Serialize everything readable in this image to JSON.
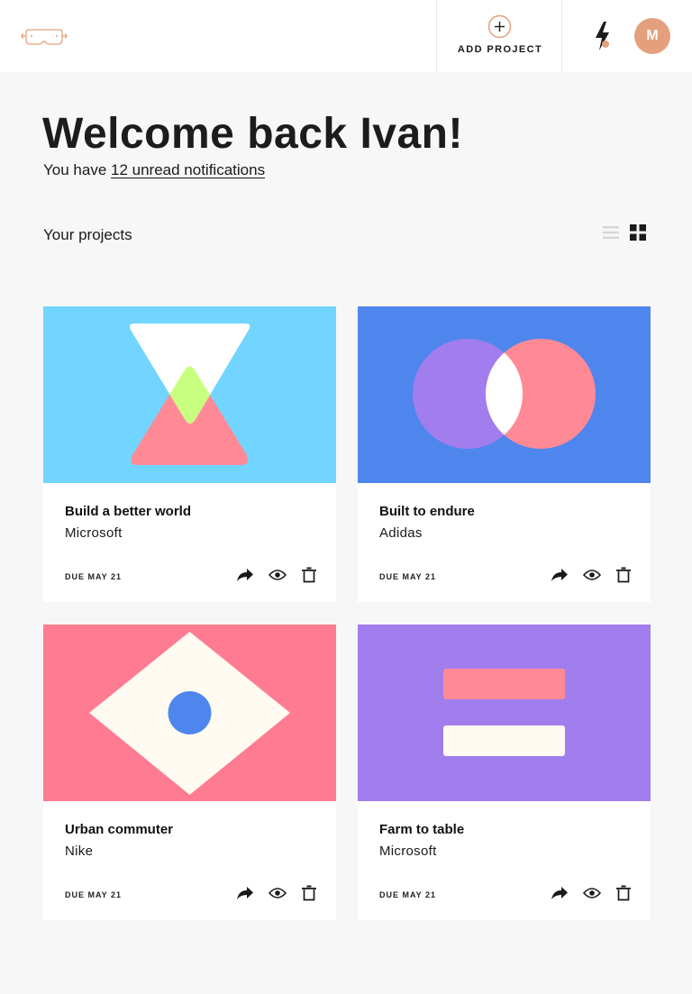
{
  "header": {
    "logo_icon": "mask-logo-icon",
    "add_project_label": "ADD PROJECT",
    "add_icon": "plus-circle-icon",
    "notification_icon": "bolt-icon",
    "avatar_initial": "M",
    "accent_color": "#e4a07d"
  },
  "welcome": {
    "title": "Welcome back Ivan!",
    "prefix": "You have ",
    "notifications_link": "12 unread notifications"
  },
  "projects": {
    "section_title": "Your projects",
    "view_options": [
      "list-view-icon",
      "grid-view-icon"
    ],
    "active_view": "grid",
    "items": [
      {
        "title": "Build a better world",
        "client": "Microsoft",
        "due": "DUE MAY 21",
        "art_color": "#72d5ff"
      },
      {
        "title": "Built to endure",
        "client": "Adidas",
        "due": "DUE MAY 21",
        "art_color": "#4f86ee"
      },
      {
        "title": "Urban commuter",
        "client": "Nike",
        "due": "DUE MAY 21",
        "art_color": "#ff7b91"
      },
      {
        "title": "Farm to table",
        "client": "Microsoft",
        "due": "DUE MAY 21",
        "art_color": "#a27ded"
      }
    ],
    "actions": [
      "share-icon",
      "eye-icon",
      "trash-icon"
    ]
  }
}
